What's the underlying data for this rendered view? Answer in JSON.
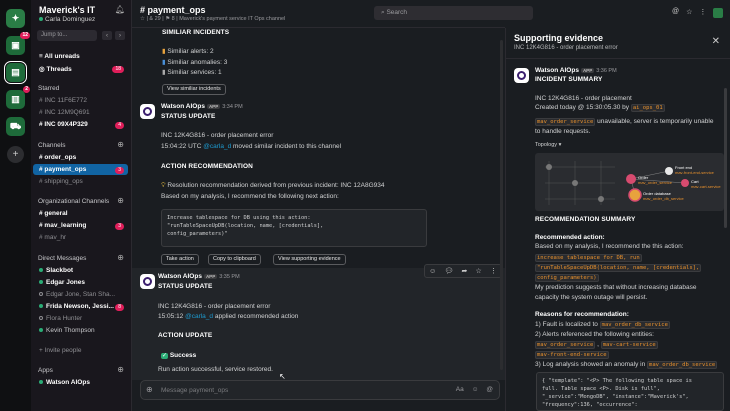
{
  "rail": {
    "badges": [
      "12",
      "2"
    ],
    "add_label": "+"
  },
  "workspace": {
    "name": "Maverick's IT",
    "user": "Carla Dominguez",
    "jump_placeholder": "Jump to..."
  },
  "sidebar": {
    "top_items": [
      {
        "label": "All unreads"
      },
      {
        "label": "Threads",
        "badge": "18"
      }
    ],
    "starred_header": "Starred",
    "starred": [
      {
        "label": "INC 11F6E772"
      },
      {
        "label": "INC 12M9Q691"
      },
      {
        "label": "INC 09X4P329",
        "badge": "4"
      }
    ],
    "channels_header": "Channels",
    "channels": [
      {
        "label": "order_ops"
      },
      {
        "label": "payment_ops",
        "badge": "3"
      },
      {
        "label": "shipping_ops"
      }
    ],
    "org_header": "Organizational Channels",
    "org_channels": [
      {
        "label": "general"
      },
      {
        "label": "mav_learning",
        "badge": "3"
      },
      {
        "label": "mav_hr"
      }
    ],
    "dm_header": "Direct Messages",
    "dms": [
      {
        "label": "Slackbot"
      },
      {
        "label": "Edgar Jones"
      },
      {
        "label": "Edgar Jone, Stan Sha..."
      },
      {
        "label": "Frida Newson, Jessi...",
        "badge": "8"
      },
      {
        "label": "Flora Hunter"
      },
      {
        "label": "Kevin Thompson"
      }
    ],
    "invite": "+ Invite people",
    "apps_header": "Apps",
    "apps": [
      {
        "label": "Watson AIOps"
      }
    ]
  },
  "channel": {
    "title": "# payment_ops",
    "meta": "☆ | & 29 | ⚑ 8 | Maverick's payment service IT Ops channel",
    "search_placeholder": "Search"
  },
  "messages": {
    "similar_head": "SIMILIAR INCIDENTS",
    "similar_alerts": "Similiar alerts: 2",
    "similar_anomalies": "Similiar anomalies: 3",
    "similar_services": "Similiar services: 1",
    "view_similar": "View similiar incidents",
    "sender": "Watson AIOps",
    "app_tag": "APP",
    "time1": "3:34 PM",
    "status_head": "STATUS UPDATE",
    "incident1": "INC 12K4G816 - order placement error",
    "time_line1_a": "15:04:22 UTC ",
    "time_line1_user": "@carla_d",
    "time_line1_b": " moved similar incident to this channel",
    "rec_head": "ACTION RECOMMENDATION",
    "rec_line": "Resolution recommendation derived from previous incident:  INC 12A8G934",
    "rec_sub": "Based on my analysis, I recommend the following next action:",
    "code_lines": [
      "Increase tablespace for DB using this action:",
      "\"runTableSpaceUpDB(location, name, [credentials],",
      "config_parameters)\""
    ],
    "btn_take": "Take action",
    "btn_copy": "Copy to clipboard",
    "btn_view": "View supporting evidence",
    "time2": "3:35 PM",
    "status_head2": "STATUS UPDATE",
    "incident2": "INC 12K4G816 - order placement error",
    "time_line2_a": "15:05:12 ",
    "time_line2_user": "@carla_d",
    "time_line2_b": " applied recommended action",
    "action_head": "ACTION UPDATE",
    "success": "Success",
    "success_sub": "Run action successful, service restored.",
    "composer_placeholder": "Message payment_ops"
  },
  "panel": {
    "title": "Supporting evidence",
    "subtitle": "INC 12K4G816 - order placement error",
    "sender": "Watson AIOps",
    "app_tag": "APP",
    "time": "3:36 PM",
    "summary_head": "INCIDENT SUMMARY",
    "incident": "INC 12K4G816 - order placement",
    "created_a": "Created today @ 15:30:05.30 by ",
    "created_code": "ai_ops_01",
    "svc_code": "mav_order_service",
    "svc_text": " unavailable, server is temporarily unable",
    "svc_text2": "to handle requests.",
    "topology_label": "Topology",
    "topo_nodes": [
      {
        "label": "Front end",
        "sub": "mav-front-end-service"
      },
      {
        "label": "Order",
        "sub": "mav_order_service"
      },
      {
        "label": "Order database",
        "sub": "mav_order_db_service"
      },
      {
        "label": "Cart",
        "sub": "mav-cart-service"
      }
    ],
    "rec_head": "RECOMMENDATION SUMMARY",
    "rec_action_label": "Recommended action:",
    "rec_action_text": "Based on my analysis, I recommend the this action:",
    "rec_code1": "increase tablespace for DB, run",
    "rec_code2": "\"runTableSpaceUpDB(location, name, [credentials],",
    "rec_code3": "config_parameters)",
    "prediction1": "My prediction suggests that without increasing database",
    "prediction2": "capacity the system outage will persist.",
    "reasons_head": "Reasons for recommendation:",
    "reason1_a": "1) Fault is localized to ",
    "reason1_code": "mav_order_db_service",
    "reason2_a": "2) Alerts referenced the following entities:",
    "reason2_code1": "mav_order_service",
    "reason2_code2": "mav-cart-service",
    "reason2_code3": "mav-front-end-service",
    "reason3_a": "3) Log analysis showed an anomaly in ",
    "reason3_code": "mav_order_db_service",
    "json_lines": [
      "{ \"template\": \"<P> The following table space is",
      "full. Table space <P>. Disk is full\",",
      "\"_service\":\"MongoDB\", \"instance\":\"Maverick's\",",
      "\"frequency\":136, \"occurrence\":"
    ]
  },
  "colors": {
    "accent": "#1164a3",
    "badge": "#e01e5a",
    "presence": "#2bac76",
    "link": "#1d9bd1",
    "code_text": "#e8912d"
  }
}
